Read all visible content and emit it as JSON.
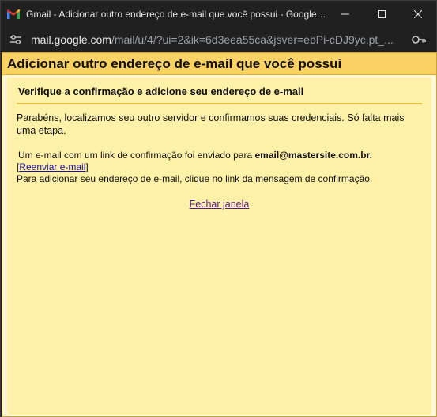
{
  "window": {
    "title": "Gmail - Adicionar outro endereço de e-mail que você possui - Google Chrome"
  },
  "url": {
    "host": "mail.google.com",
    "path": "/mail/u/4/?ui=2&ik=6d3eea55ca&jsver=ebPi-cDJ9yc.pt_..."
  },
  "page": {
    "title": "Adicionar outro endereço de e-mail que você possui",
    "subtitle": "Verifique a confirmação e adicione seu endereço de e-mail",
    "congrats": "Parabéns, localizamos seu outro servidor e confirmamos suas credenciais. Só falta mais uma etapa.",
    "sent_text": "Um e-mail com um link de confirmação foi enviado para ",
    "email": "email@mastersite.com.br.",
    "bracket_open": "[",
    "resend_link": "Reenviar e-mail",
    "bracket_close": "]",
    "instructions": "Para adicionar seu endereço de e-mail, clique no link da mensagem de confirmação.",
    "close_link": "Fechar janela"
  },
  "colors": {
    "header_bg": "#fad163",
    "panel_bg": "#fff1a8",
    "link": "#1a0dab",
    "visited_link": "#551a8b"
  },
  "icons": {
    "app": "gmail-icon",
    "minimize": "minimize-icon",
    "maximize": "maximize-icon",
    "close": "close-icon",
    "site_settings": "tune-icon",
    "password": "key-icon"
  }
}
